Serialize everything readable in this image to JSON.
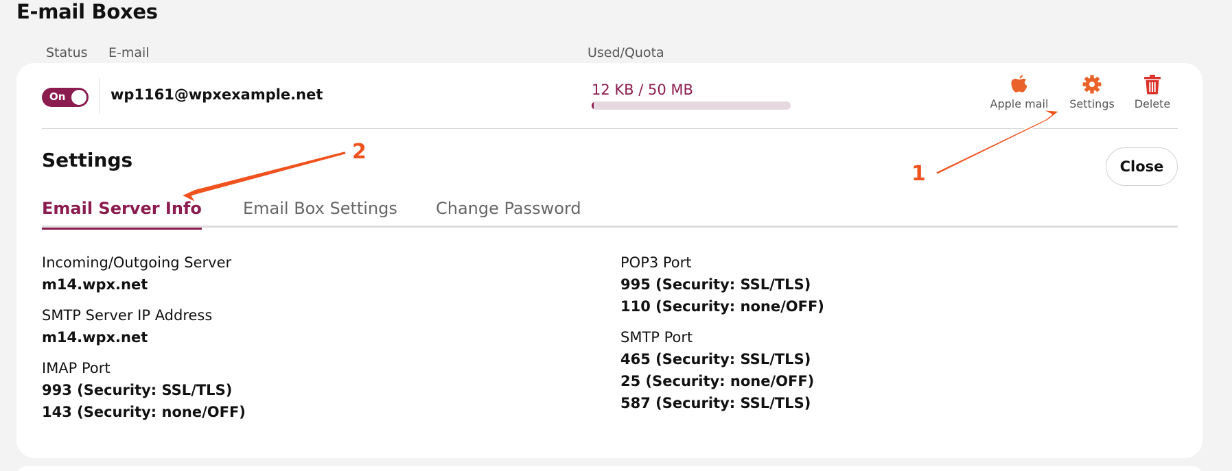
{
  "page": {
    "title": "E-mail Boxes"
  },
  "columns": {
    "status": "Status",
    "email": "E-mail",
    "used_quota": "Used/Quota"
  },
  "mailbox": {
    "status_label": "On",
    "email": "wp1161@wpxexample.net",
    "quota_text": "12 KB / 50 MB",
    "quota_fraction": 0.0002
  },
  "actions": {
    "apple_mail": {
      "label": "Apple mail",
      "icon": "apple-icon"
    },
    "settings": {
      "label": "Settings",
      "icon": "gear-icon"
    },
    "delete": {
      "label": "Delete",
      "icon": "trash-icon"
    }
  },
  "settings_panel": {
    "title": "Settings",
    "close_label": "Close",
    "tabs": [
      {
        "label": "Email Server Info",
        "active": true
      },
      {
        "label": "Email Box Settings",
        "active": false
      },
      {
        "label": "Change Password",
        "active": false
      }
    ]
  },
  "server_info": {
    "left": [
      {
        "label": "Incoming/Outgoing Server",
        "values": [
          "m14.wpx.net"
        ]
      },
      {
        "label": "SMTP Server IP Address",
        "values": [
          "m14.wpx.net"
        ]
      },
      {
        "label": "IMAP Port",
        "values": [
          "993 (Security: SSL/TLS)",
          "143 (Security: none/OFF)"
        ]
      }
    ],
    "right": [
      {
        "label": "POP3 Port",
        "values": [
          "995 (Security: SSL/TLS)",
          "110 (Security: none/OFF)"
        ]
      },
      {
        "label": "SMTP Port",
        "values": [
          "465 (Security: SSL/TLS)",
          "25 (Security: none/OFF)",
          "587 (Security: SSL/TLS)"
        ]
      }
    ]
  },
  "annotations": {
    "marker_1": "1",
    "marker_2": "2"
  },
  "colors": {
    "accent": "#8b1c4f",
    "action_icon": "#e8622a",
    "annotation": "#f0521e"
  }
}
